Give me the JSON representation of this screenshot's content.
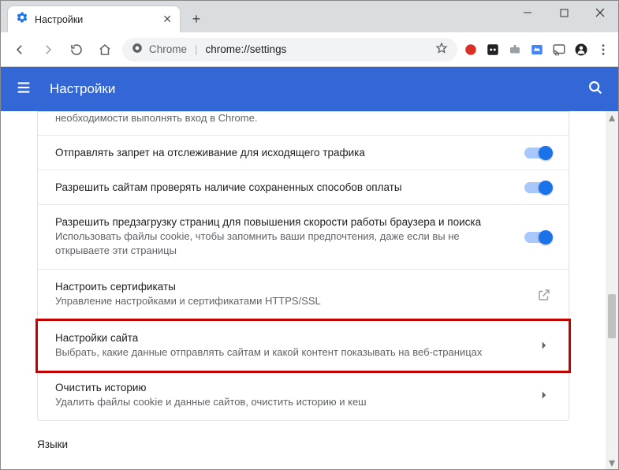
{
  "window": {
    "tab_title": "Настройки"
  },
  "toolbar": {
    "url_host": "Chrome",
    "url_path": "chrome://settings"
  },
  "header": {
    "title": "Настройки"
  },
  "settings": {
    "partial_text": "необходимости выполнять вход в Chrome.",
    "rows": [
      {
        "label": "Отправлять запрет на отслеживание для исходящего трафика",
        "desc": "",
        "control": "toggle"
      },
      {
        "label": "Разрешить сайтам проверять наличие сохраненных способов оплаты",
        "desc": "",
        "control": "toggle"
      },
      {
        "label": "Разрешить предзагрузку страниц для повышения скорости работы браузера и поиска",
        "desc": "Использовать файлы cookie, чтобы запомнить ваши предпочтения, даже если вы не открываете эти страницы",
        "control": "toggle"
      },
      {
        "label": "Настроить сертификаты",
        "desc": "Управление настройками и сертификатами HTTPS/SSL",
        "control": "external"
      },
      {
        "label": "Настройки сайта",
        "desc": "Выбрать, какие данные отправлять сайтам и какой контент показывать на веб-страницах",
        "control": "arrow"
      },
      {
        "label": "Очистить историю",
        "desc": "Удалить файлы cookie и данные сайтов, очистить историю и кеш",
        "control": "arrow"
      }
    ],
    "section_label": "Языки"
  }
}
